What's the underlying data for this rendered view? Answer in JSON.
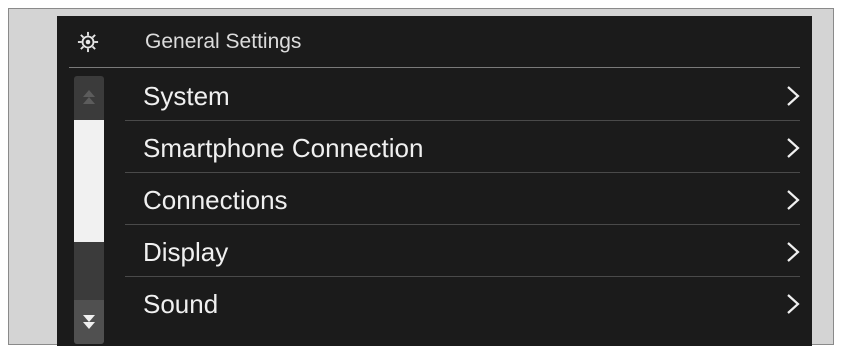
{
  "header": {
    "icon": "gear-icon",
    "title": "General Settings"
  },
  "menu": {
    "items": [
      {
        "label": "System",
        "icon": "chevron-right-icon"
      },
      {
        "label": "Smartphone Connection",
        "icon": "chevron-right-icon"
      },
      {
        "label": "Connections",
        "icon": "chevron-right-icon"
      },
      {
        "label": "Display",
        "icon": "chevron-right-icon"
      },
      {
        "label": "Sound",
        "icon": "chevron-right-icon"
      }
    ]
  },
  "scrollbar": {
    "up_icon": "scroll-up-icon",
    "down_icon": "scroll-down-icon"
  },
  "colors": {
    "screen_bg": "#1b1b1b",
    "text": "#f0f0f0",
    "thumb": "#f1f1f1"
  }
}
